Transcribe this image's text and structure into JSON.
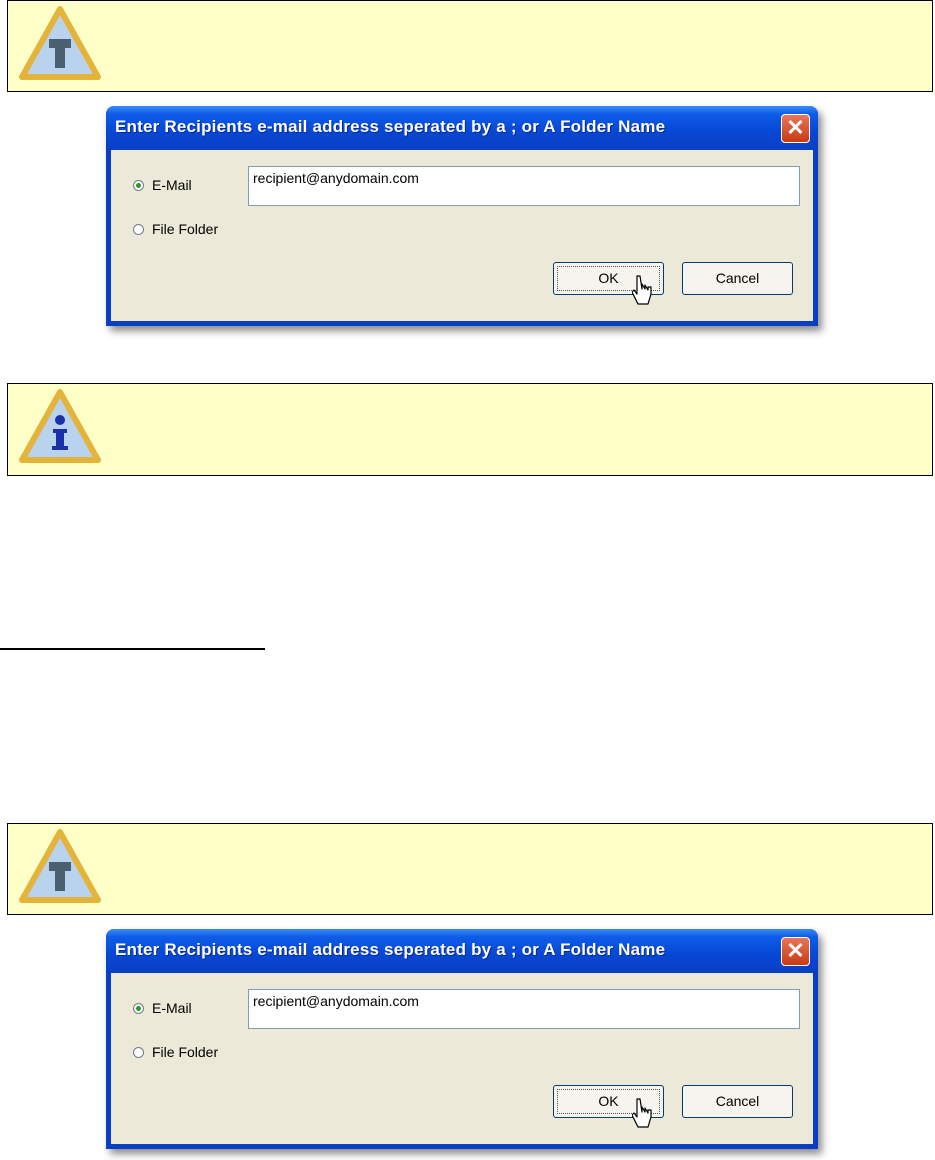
{
  "notes": [
    {
      "icon": "tip-icon"
    },
    {
      "icon": "info-icon"
    },
    {
      "icon": "tip-icon"
    }
  ],
  "dialog": {
    "title": "Enter Recipients e-mail address seperated by a ; or A Folder Name",
    "close_glyph": "✕",
    "email_label": "E-Mail",
    "folder_label": "File Folder",
    "email_value": "recipient@anydomain.com",
    "selected_option": "E-Mail",
    "ok_label": "OK",
    "cancel_label": "Cancel"
  },
  "colors": {
    "note_background": "#ffffc8",
    "titlebar_blue": "#0747d4",
    "dialog_face": "#ece9d8",
    "close_red": "#c83a12"
  }
}
